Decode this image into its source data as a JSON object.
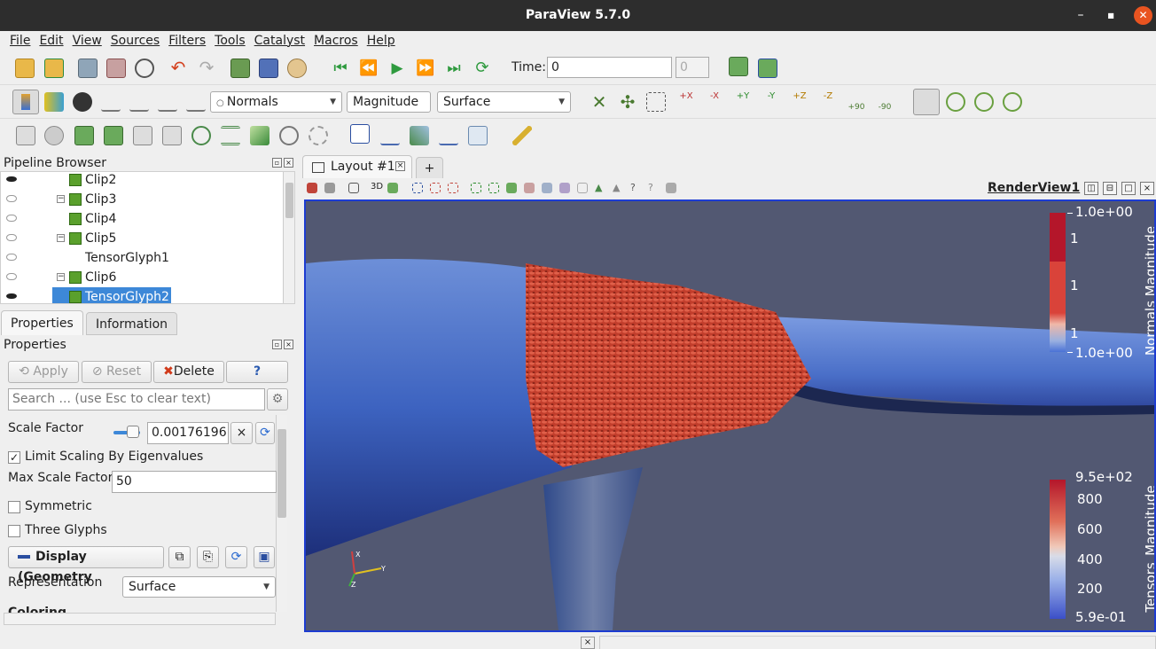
{
  "window": {
    "title": "ParaView 5.7.0",
    "minimize": "–",
    "maximize": "■",
    "close": "✕"
  },
  "menu": [
    "File",
    "Edit",
    "View",
    "Sources",
    "Filters",
    "Tools",
    "Catalyst",
    "Macros",
    "Help"
  ],
  "toolbar1": {
    "time_label": "Time:",
    "time_value": "0",
    "timestep_value": "0"
  },
  "toolbar2": {
    "color_by": "Normals",
    "component": "Magnitude",
    "representation": "Surface"
  },
  "camera_buttons": [
    "+X",
    "-X",
    "+Y",
    "-Y",
    "+Z",
    "-Z",
    "+90",
    "-90"
  ],
  "pipeline": {
    "title": "Pipeline Browser",
    "items": [
      {
        "label": "Clip2",
        "visible": true,
        "expander": false,
        "selected": false
      },
      {
        "label": "Clip3",
        "visible": false,
        "expander": true,
        "selected": false
      },
      {
        "label": "Clip4",
        "visible": false,
        "expander": false,
        "selected": false
      },
      {
        "label": "Clip5",
        "visible": false,
        "expander": true,
        "selected": false
      },
      {
        "label": "TensorGlyph1",
        "visible": false,
        "expander": false,
        "selected": false
      },
      {
        "label": "Clip6",
        "visible": false,
        "expander": true,
        "selected": false
      },
      {
        "label": "TensorGlyph2",
        "visible": true,
        "expander": false,
        "selected": true
      }
    ]
  },
  "panel_tabs": {
    "properties": "Properties",
    "information": "Information"
  },
  "properties": {
    "title": "Properties",
    "apply": "Apply",
    "reset": "Reset",
    "delete": "Delete",
    "help": "?",
    "search_placeholder": "Search ... (use Esc to clear text)",
    "scale_factor_label": "Scale Factor",
    "scale_factor_value": "0.00176196",
    "limit_scaling_label": "Limit Scaling By Eigenvalues",
    "limit_scaling_checked": true,
    "max_scale_factor_label": "Max Scale Factor",
    "max_scale_factor_value": "50",
    "symmetric_label": "Symmetric",
    "symmetric_checked": false,
    "three_glyphs_label": "Three Glyphs",
    "three_glyphs_checked": false,
    "display_section": "Display (Geometry",
    "representation_label": "Representation",
    "representation_value": "Surface",
    "coloring_section": "Coloring"
  },
  "layout": {
    "tab": "Layout #1",
    "add_tab": "+",
    "view_name": "RenderView1",
    "mode_3d": "3D"
  },
  "legend_normals": {
    "title": "Normals Magnitude",
    "top": "1.0e+00",
    "ticks": [
      "1",
      "1",
      "1"
    ],
    "bottom": "1.0e+00"
  },
  "legend_tensors": {
    "title": "Tensors_Magnitude",
    "top": "9.5e+02",
    "ticks": [
      "800",
      "600",
      "400",
      "200"
    ],
    "bottom": "5.9e-01"
  },
  "axes": {
    "x": "X",
    "y": "Y",
    "z": "Z"
  },
  "colors": {
    "view_bg": "#525872",
    "view_border": "#1d3cd1",
    "selection": "#3d88d8",
    "glyph_red": "#c8412f",
    "surface_blue": "#3a5fb8"
  }
}
